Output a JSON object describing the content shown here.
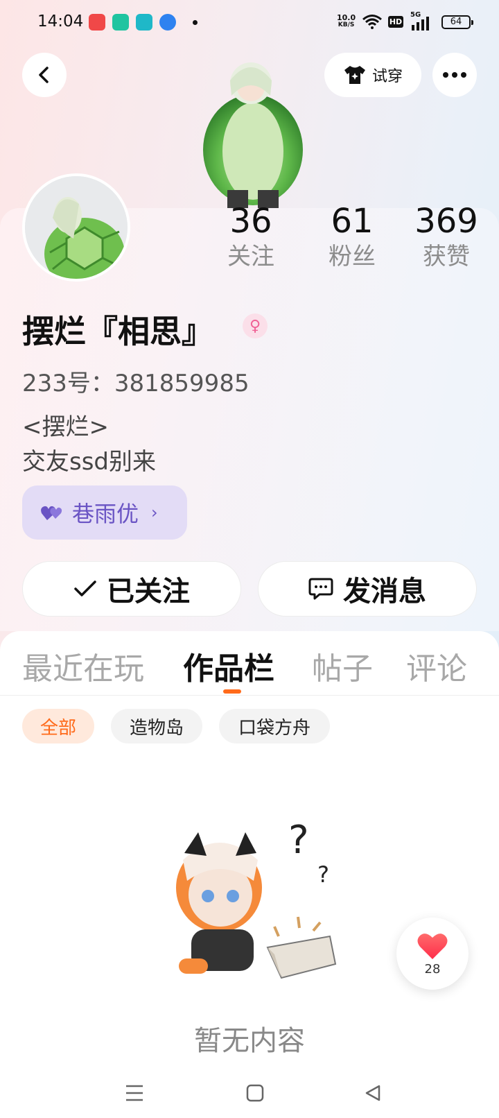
{
  "status_bar": {
    "time": "14:04",
    "net_speed_value": "10.0",
    "net_speed_unit": "KB/S",
    "hd": "HD",
    "signal": "5G",
    "battery": "64"
  },
  "header": {
    "try_on_label": "试穿"
  },
  "profile": {
    "stats": [
      {
        "value": "36",
        "label": "关注"
      },
      {
        "value": "61",
        "label": "粉丝"
      },
      {
        "value": "369",
        "label": "获赞"
      }
    ],
    "username": "摆烂『相思』",
    "id_line": "233号：381859985",
    "bio_line1": "<摆烂>",
    "bio_line2": "交友ssd别来",
    "intimate_friend": "巷雨优",
    "follow_label": "已关注",
    "message_label": "发消息"
  },
  "tabs": [
    "最近在玩",
    "作品栏",
    "帖子",
    "评论"
  ],
  "active_tab": "作品栏",
  "filters": [
    "全部",
    "造物岛",
    "口袋方舟"
  ],
  "empty_text": "暂无内容",
  "like_fab": {
    "count": "28"
  },
  "colors": {
    "accent": "#ff6a1a",
    "intimate": "#6a54c4",
    "heart": "#ff3b4e"
  }
}
